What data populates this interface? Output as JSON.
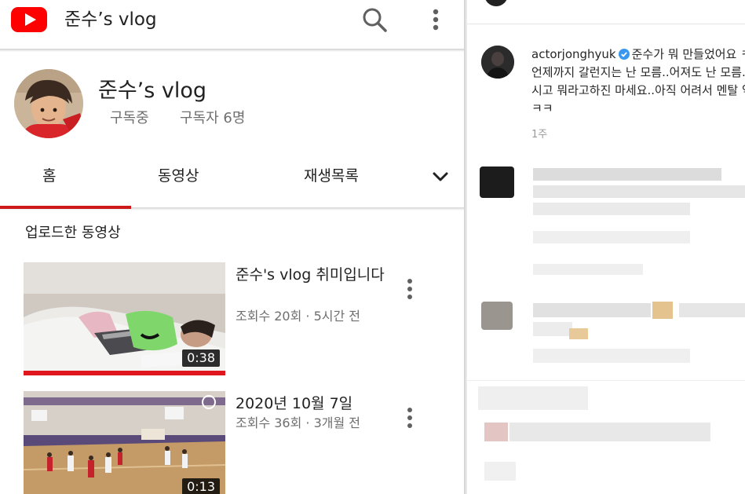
{
  "youtube": {
    "brand_color": "#ff0000",
    "header": {
      "title": "준수’s vlog",
      "search_icon": "search-icon",
      "more_icon": "more-vert-icon"
    },
    "channel": {
      "name": "준수’s vlog",
      "subscribed_label": "구독중",
      "subscriber_count": "구독자 6명"
    },
    "tabs": [
      {
        "label": "홈",
        "active": true
      },
      {
        "label": "동영상",
        "active": false
      },
      {
        "label": "재생목록",
        "active": false
      }
    ],
    "tabs_more_icon": "chevron-down-icon",
    "section_title": "업로드한 동영상",
    "videos": [
      {
        "title": "준수's vlog 취미입니다",
        "meta": "조회수 20회 · 5시간 전",
        "duration": "0:38",
        "watched_fraction": 1.0
      },
      {
        "title": "2020년 10월 7일",
        "meta": "조회수 36회 · 3개월 전",
        "duration": "0:13",
        "watched_fraction": 0
      }
    ]
  },
  "instagram": {
    "post": {
      "username": "actorjonghyuk",
      "verified": true,
      "caption": "준수가 뭐 만들었어요 ㅋㅋ 언제까지 갈런지는 난 모름..어져도 난 모름..보시고 뭐라고하진 마세요..아직 어려서 멘탈 약함 ㅋㅋ",
      "time": "1주"
    },
    "accent_color": "#3897f0"
  }
}
